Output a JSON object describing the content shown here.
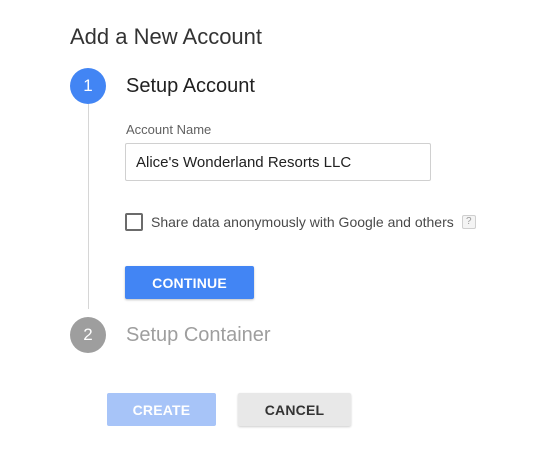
{
  "page": {
    "title": "Add a New Account"
  },
  "steps": [
    {
      "number": "1",
      "title": "Setup Account",
      "state": "active"
    },
    {
      "number": "2",
      "title": "Setup Container",
      "state": "inactive"
    }
  ],
  "account_form": {
    "account_name_label": "Account Name",
    "account_name_value": "Alice's Wonderland Resorts LLC",
    "share_data_label": "Share data anonymously with Google and others",
    "share_data_checked": false,
    "help_icon": "question-mark-icon",
    "help_glyph": "?",
    "continue_label": "CONTINUE"
  },
  "footer": {
    "create_label": "CREATE",
    "cancel_label": "CANCEL"
  },
  "colors": {
    "primary": "#4285f4",
    "primary_disabled": "#a7c4f8",
    "inactive_step": "#9e9e9e",
    "cancel_bg": "#e8e8e8"
  }
}
